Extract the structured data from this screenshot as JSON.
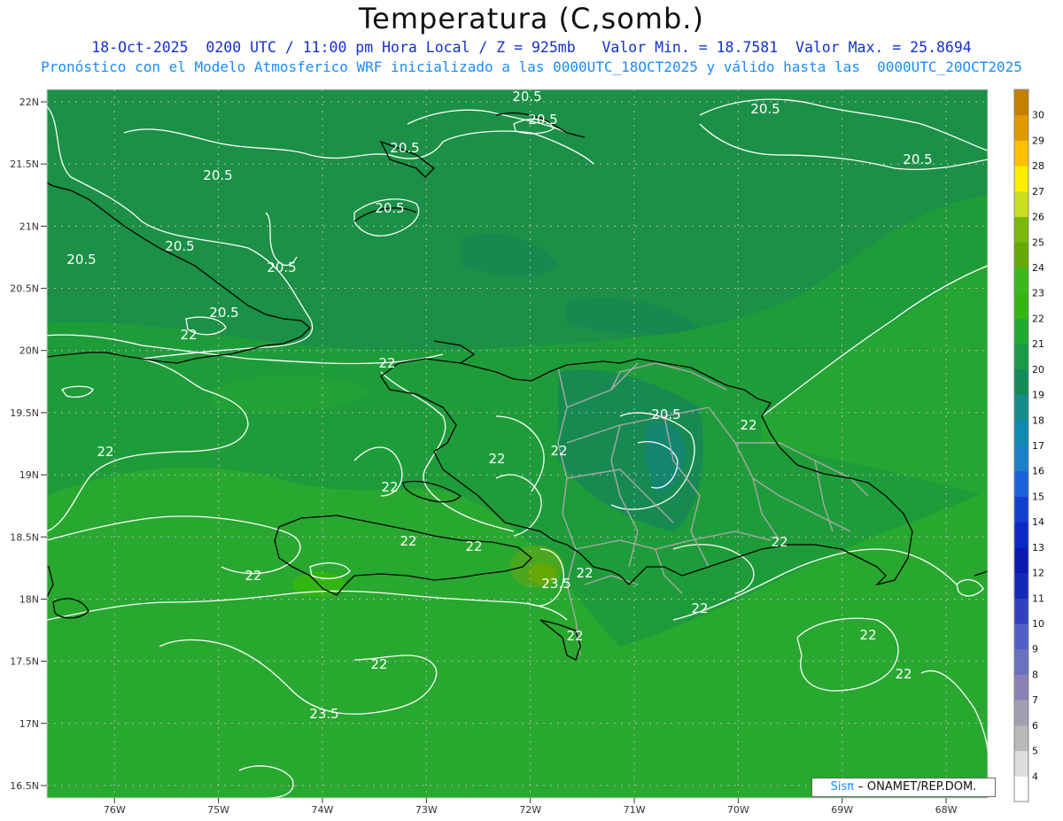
{
  "title": "Temperatura (C,somb.)",
  "subtitle_line1": "18-Oct-2025  0200 UTC / 11:00 pm Hora Local / Z = 925mb   Valor Min. = 18.7581  Valor Max. = 25.8694",
  "subtitle_line2": "Pronóstico con el Modelo Atmosferico WRF inicializado a las 0000UTC_18OCT2025 y válido hasta las  0000UTC_20OCT2025",
  "credit": {
    "sis": "Sisπ",
    "rest": "– ONAMET/REP.DOM."
  },
  "colors": {
    "background": "#ffffff",
    "ocean_fill": "#1f9c3a",
    "contour": "#ffffff",
    "coast": "#000000",
    "borders": "#a0a0a0"
  },
  "chart_data": {
    "type": "heatmap",
    "title": "Temperatura (C,somb.)",
    "variable": "Temperature at 925mb",
    "units": "C",
    "min_value": 18.7581,
    "max_value": 25.8694,
    "lat_ticks": [
      "22N",
      "21.5N",
      "21N",
      "20.5N",
      "20N",
      "19.5N",
      "19N",
      "18.5N",
      "18N",
      "17.5N",
      "17N",
      "16.5N"
    ],
    "lon_ticks": [
      "76W",
      "75W",
      "74W",
      "73W",
      "72W",
      "71W",
      "70W",
      "69W",
      "68W"
    ],
    "lat_range": [
      16.4,
      22.1
    ],
    "lon_range": [
      -76.65,
      -67.6
    ],
    "colorbar": {
      "labels": [
        "4",
        "5",
        "6",
        "7",
        "8",
        "9",
        "10",
        "11",
        "12",
        "13",
        "14",
        "15",
        "16",
        "17",
        "18",
        "19",
        "20",
        "21",
        "22",
        "23",
        "24",
        "25",
        "26",
        "27",
        "28",
        "29",
        "30"
      ],
      "colors": [
        "#ffffff",
        "#dcdcdc",
        "#b9b9b9",
        "#a0a0b0",
        "#8a80b8",
        "#6c70c0",
        "#5060c8",
        "#3040c0",
        "#1428b8",
        "#0a18b0",
        "#0a28c8",
        "#1040d0",
        "#1a60d8",
        "#1a80c8",
        "#0f8ab0",
        "#148c8c",
        "#128a5a",
        "#189a48",
        "#20aa30",
        "#33b512",
        "#3cb81a",
        "#66a808",
        "#7ab80c",
        "#c8e01e",
        "#ffee00",
        "#ffc000",
        "#e09a00",
        "#c48000"
      ]
    },
    "contour_labels": [
      "20.5",
      "20.5",
      "20.5",
      "20.5",
      "20.5",
      "20.5",
      "20.5",
      "20.5",
      "20.5",
      "20.5",
      "20.5",
      "20.5",
      "22",
      "22",
      "22",
      "22",
      "22",
      "22",
      "22",
      "22",
      "22",
      "22",
      "22",
      "22",
      "22",
      "22",
      "22",
      "22",
      "22",
      "23.5"
    ]
  }
}
